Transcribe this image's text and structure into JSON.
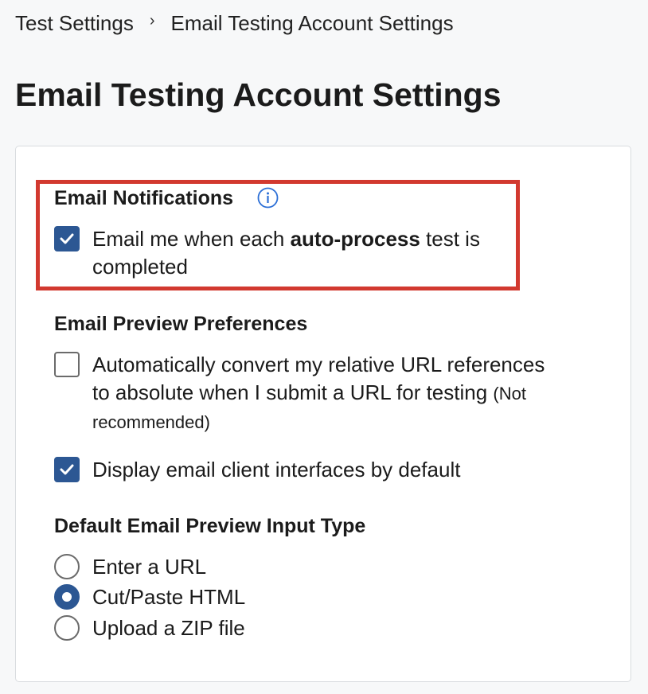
{
  "breadcrumb": {
    "parent": "Test Settings",
    "separator": "›",
    "current": "Email Testing Account Settings"
  },
  "page_title": "Email Testing Account Settings",
  "notifications": {
    "heading": "Email Notifications",
    "info_icon": "info-icon",
    "option": {
      "text_before": "Email me when each ",
      "text_bold": "auto-process",
      "text_after_line1": " test is",
      "text_line2": "completed",
      "checked": true
    }
  },
  "preview_preferences": {
    "heading": "Email Preview Preferences",
    "convert_urls": {
      "line1": "Automatically convert my relative URL references",
      "line2": "to absolute when I submit a URL for testing",
      "note_part1": "(Not",
      "note_part2": "recommended)",
      "checked": false
    },
    "display_clients": {
      "label": "Display email client interfaces by default",
      "checked": true
    }
  },
  "input_type": {
    "heading": "Default Email Preview Input Type",
    "options": [
      {
        "label": "Enter a URL",
        "selected": false
      },
      {
        "label": "Cut/Paste HTML",
        "selected": true
      },
      {
        "label": "Upload a ZIP file",
        "selected": false
      }
    ]
  },
  "colors": {
    "accent": "#2c5793",
    "highlight_border": "#d2392f",
    "background": "#f7f8f9",
    "info_icon": "#2c6fd6"
  }
}
